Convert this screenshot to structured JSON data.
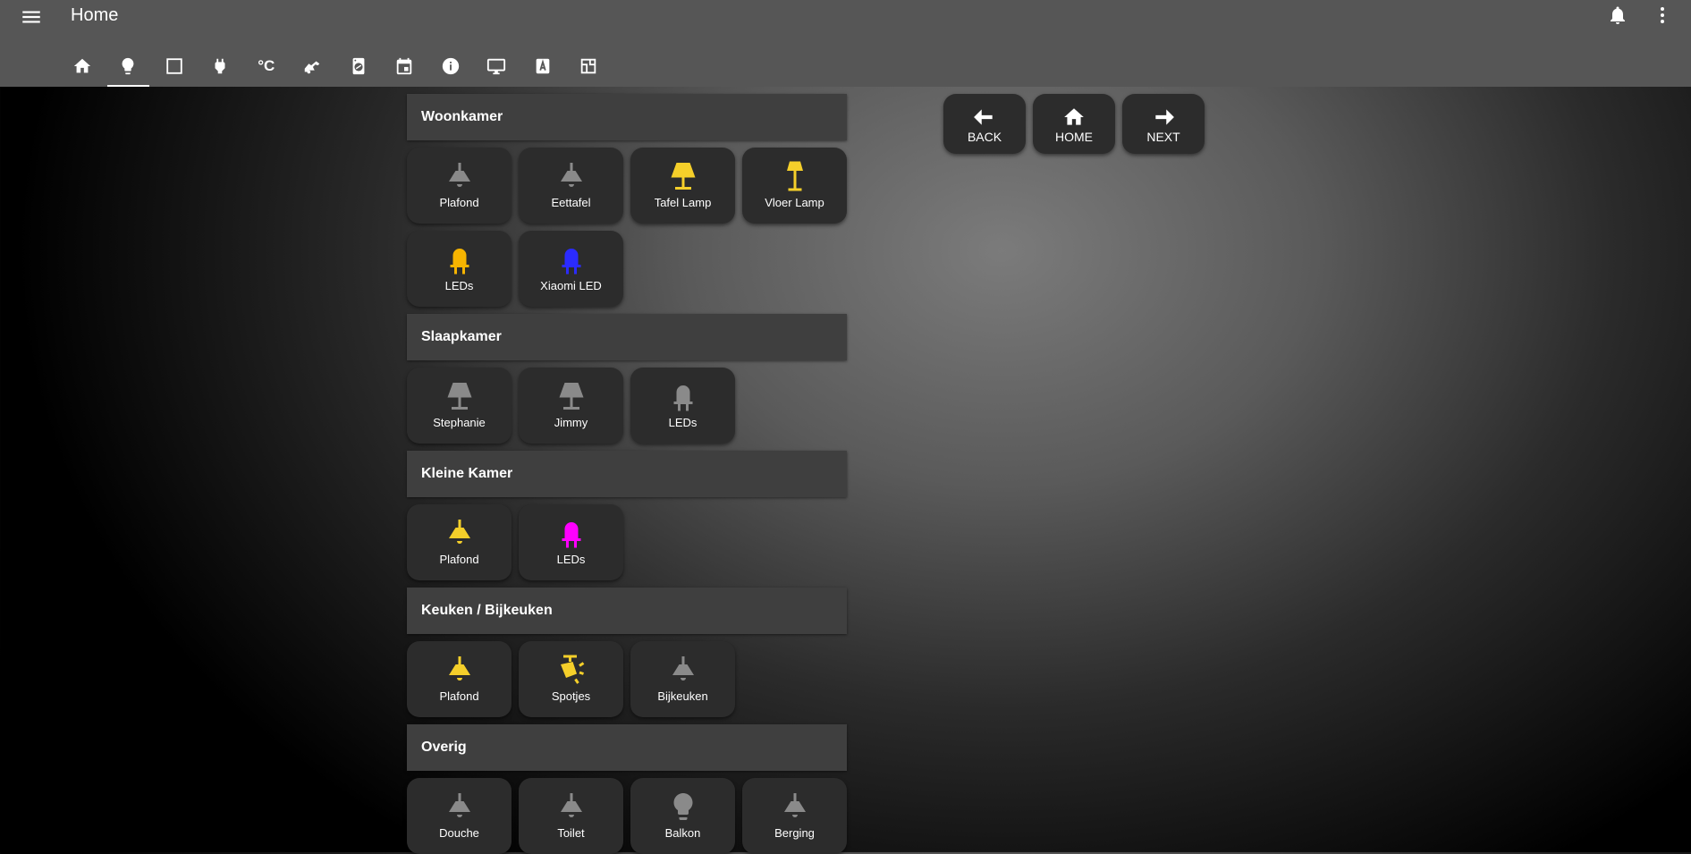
{
  "app": {
    "title": "Home",
    "icons": {
      "menu": "menu-icon",
      "notifications": "bell-icon",
      "more": "more-vert-icon"
    }
  },
  "tabs": [
    {
      "icon": "home-icon",
      "active": false
    },
    {
      "icon": "lightbulb-icon",
      "active": true
    },
    {
      "icon": "window-icon",
      "active": false
    },
    {
      "icon": "plug-icon",
      "active": false
    },
    {
      "icon": "temperature-icon",
      "text": "°C",
      "active": false
    },
    {
      "icon": "vacuum-robot-icon",
      "active": false
    },
    {
      "icon": "washing-machine-icon",
      "active": false
    },
    {
      "icon": "calendar-icon",
      "active": false
    },
    {
      "icon": "info-icon",
      "active": false
    },
    {
      "icon": "monitor-icon",
      "active": false
    },
    {
      "icon": "alpha-a-box-icon",
      "active": false
    },
    {
      "icon": "floor-plan-icon",
      "active": false
    }
  ],
  "colors": {
    "on_yellow": "#f5cf2a",
    "off_gray": "#8a8a8a",
    "led_blue": "#2b2bff",
    "led_magenta": "#ff00ff",
    "led_amber": "#f6b400"
  },
  "sections": [
    {
      "title": "Woonkamer",
      "tiles": [
        {
          "label": "Plafond",
          "icon": "ceiling-light-icon",
          "color": "#8a8a8a"
        },
        {
          "label": "Eettafel",
          "icon": "ceiling-light-icon",
          "color": "#8a8a8a"
        },
        {
          "label": "Tafel Lamp",
          "icon": "table-lamp-icon",
          "color": "#f5cf2a"
        },
        {
          "label": "Vloer Lamp",
          "icon": "floor-lamp-icon",
          "color": "#f5cf2a"
        },
        {
          "label": "LEDs",
          "icon": "led-icon",
          "color": "#f6b400"
        },
        {
          "label": "Xiaomi LED",
          "icon": "led-icon",
          "color": "#2b2bff"
        }
      ]
    },
    {
      "title": "Slaapkamer",
      "tiles": [
        {
          "label": "Stephanie",
          "icon": "table-lamp-icon",
          "color": "#8a8a8a"
        },
        {
          "label": "Jimmy",
          "icon": "table-lamp-icon",
          "color": "#8a8a8a"
        },
        {
          "label": "LEDs",
          "icon": "led-icon",
          "color": "#8a8a8a"
        }
      ]
    },
    {
      "title": "Kleine Kamer",
      "tiles": [
        {
          "label": "Plafond",
          "icon": "ceiling-light-icon",
          "color": "#f5cf2a"
        },
        {
          "label": "LEDs",
          "icon": "led-icon",
          "color": "#ff00ff"
        }
      ]
    },
    {
      "title": "Keuken / Bijkeuken",
      "tiles": [
        {
          "label": "Plafond",
          "icon": "ceiling-light-icon",
          "color": "#f5cf2a"
        },
        {
          "label": "Spotjes",
          "icon": "spotlight-icon",
          "color": "#f5cf2a"
        },
        {
          "label": "Bijkeuken",
          "icon": "ceiling-light-icon",
          "color": "#8a8a8a"
        }
      ]
    },
    {
      "title": "Overig",
      "tiles": [
        {
          "label": "Douche",
          "icon": "ceiling-light-icon",
          "color": "#8a8a8a"
        },
        {
          "label": "Toilet",
          "icon": "ceiling-light-icon",
          "color": "#8a8a8a"
        },
        {
          "label": "Balkon",
          "icon": "lightbulb-icon",
          "color": "#8a8a8a"
        },
        {
          "label": "Berging",
          "icon": "ceiling-light-icon",
          "color": "#8a8a8a"
        }
      ]
    }
  ],
  "nav_buttons": [
    {
      "label": "BACK",
      "icon": "arrow-left-icon"
    },
    {
      "label": "HOME",
      "icon": "home-icon"
    },
    {
      "label": "NEXT",
      "icon": "arrow-right-icon"
    }
  ]
}
